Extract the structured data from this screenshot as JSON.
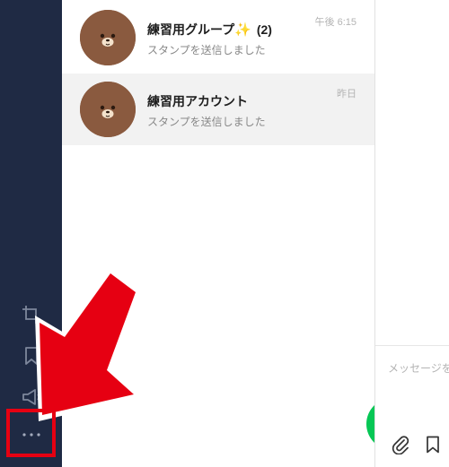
{
  "sidebar": {
    "items": [
      {
        "name": "crop-icon"
      },
      {
        "name": "keep-icon"
      },
      {
        "name": "announce-icon"
      },
      {
        "name": "more-icon"
      }
    ]
  },
  "chats": [
    {
      "name": "練習用グループ",
      "badge": "(2)",
      "preview": "スタンプを送信しました",
      "time": "午後 6:15"
    },
    {
      "name": "練習用アカウント",
      "preview": "スタンプを送信しました",
      "time": "昨日"
    }
  ],
  "compose": {
    "placeholder": "メッセージを入力"
  },
  "colors": {
    "sidebar_bg": "#1f2a44",
    "accent_green": "#06c755",
    "annotation_red": "#e60012",
    "selected_row": "#f2f2f2"
  }
}
